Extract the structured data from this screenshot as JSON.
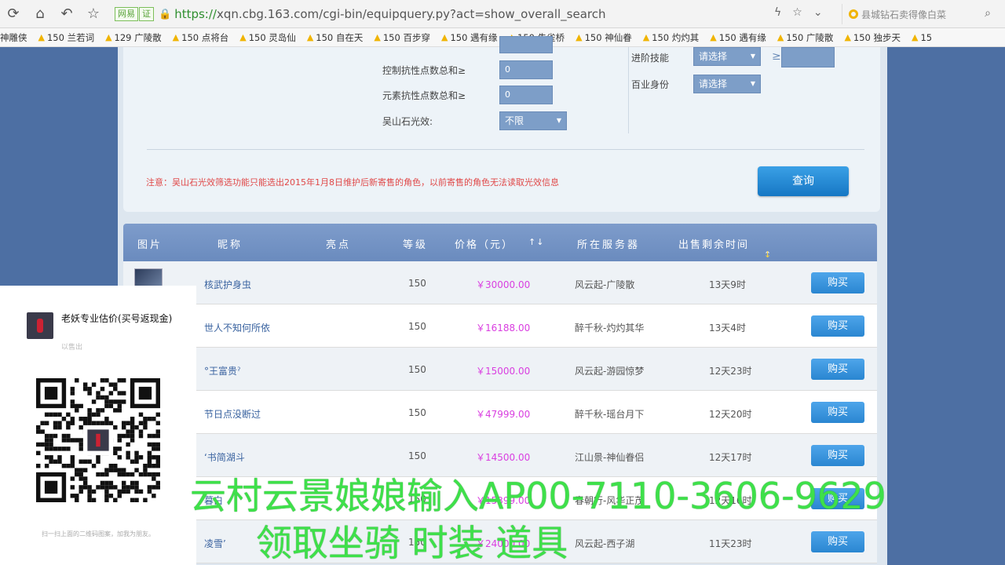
{
  "browser": {
    "badge": "网易",
    "badge2": "证",
    "url_https": "https://",
    "url_rest": "xqn.cbg.163.com/cgi-bin/equipquery.py?act=show_overall_search",
    "search_text": "县城钻石卖得像白菜"
  },
  "bookmarks": [
    {
      "label": "神雕侠"
    },
    {
      "label": "150 兰若词"
    },
    {
      "label": "129 广陵散"
    },
    {
      "label": "150 点将台"
    },
    {
      "label": "150 灵岛仙"
    },
    {
      "label": "150 自在天"
    },
    {
      "label": "150 百步穿"
    },
    {
      "label": "150 遇有缘"
    },
    {
      "label": "150 朱雀桥"
    },
    {
      "label": "150 神仙眷"
    },
    {
      "label": "150 灼灼其"
    },
    {
      "label": "150 遇有缘"
    },
    {
      "label": "150 广陵散"
    },
    {
      "label": "150 独步天"
    },
    {
      "label": "15"
    }
  ],
  "form": {
    "control_resist_label": "控制抗性点数总和≥",
    "control_resist_value": "0",
    "element_resist_label": "元素抗性点数总和≥",
    "element_resist_value": "0",
    "wushan_label": "吴山石光效:",
    "wushan_value": "不限",
    "advanced_skill_label": "进阶技能",
    "advanced_skill_value": "请选择",
    "profession_label": "百业身份",
    "profession_value": "请选择",
    "gt_symbol": "≥",
    "notice": "注意：吴山石光效筛选功能只能选出2015年1月8日维护后新寄售的角色，以前寄售的角色无法读取光效信息",
    "query_button": "查询"
  },
  "table": {
    "headers": {
      "image": "图片",
      "nickname": "昵称",
      "highlight": "亮点",
      "level": "等级",
      "price": "价格（元）",
      "server": "所在服务器",
      "remaining": "出售剩余时间"
    },
    "sort_arrows": "↑↓",
    "buy_label": "购买",
    "rows": [
      {
        "nickname": "核武护身虫",
        "level": "150",
        "price": "￥30000.00",
        "server": "风云起-广陵散",
        "time": "13天9时"
      },
      {
        "nickname": "世人不知何所依",
        "level": "150",
        "price": "￥16188.00",
        "server": "醉千秋-灼灼其华",
        "time": "13天4时"
      },
      {
        "nickname": "°王富贵ˀ",
        "level": "150",
        "price": "￥15000.00",
        "server": "风云起-游园惊梦",
        "time": "12天23时"
      },
      {
        "nickname": "节日点没断过",
        "level": "150",
        "price": "￥47999.00",
        "server": "醉千秋-瑶台月下",
        "time": "12天20时"
      },
      {
        "nickname": "‘书简湖斗",
        "level": "150",
        "price": "￥14500.00",
        "server": "江山景-神仙眷侣",
        "time": "12天17时"
      },
      {
        "nickname": "暮白",
        "level": "150",
        "price": "￥15399.00",
        "server": "春朝行-风华正茂",
        "time": "12天16时"
      },
      {
        "nickname": "凌雪’",
        "level": "150",
        "price": "￥24000.00",
        "server": "风云起-西子湖",
        "time": "11天23时"
      }
    ]
  },
  "popup": {
    "title": "老妖专业估价(买号返现金)",
    "subtitle": "以售出",
    "footer": "扫一扫上面的二维码图案，加我为朋友。"
  },
  "overlay": {
    "line1": "云村云景娘娘输入AP00-7110-3606-9629",
    "line2": "领取坐骑 时装 道具"
  }
}
